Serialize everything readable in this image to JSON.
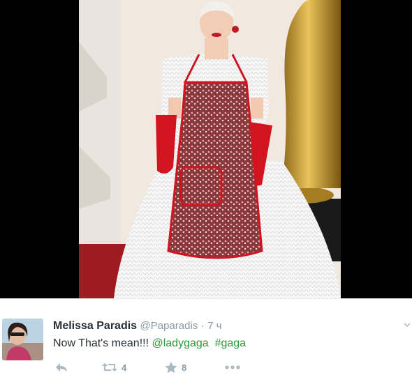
{
  "tweet": {
    "display_name": "Melissa Paradis",
    "handle": "@Paparadis",
    "separator": "·",
    "time": "7 ч",
    "text_lead": "Now That's mean!!! ",
    "mention": "@ladygaga",
    "text_gap": "  ",
    "hashtag": "#gaga",
    "retweet_count": "4",
    "favorite_count": "8"
  },
  "icons": {
    "reply": "reply-icon",
    "retweet": "retweet-icon",
    "favorite": "star-icon",
    "more": "more-dots-icon",
    "caret": "chevron-down-icon"
  },
  "colors": {
    "link": "#2a9a3a",
    "name": "#292f33",
    "meta": "#8899a6",
    "action_icon": "#aab8c2"
  }
}
